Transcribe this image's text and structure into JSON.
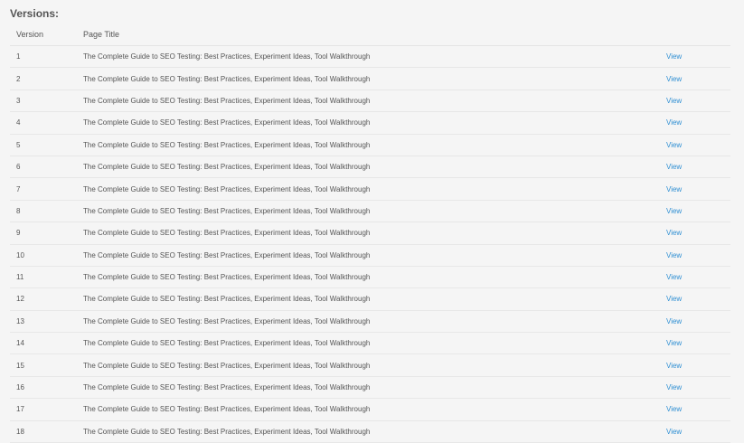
{
  "section": {
    "title": "Versions:"
  },
  "table": {
    "headers": {
      "version": "Version",
      "page_title": "Page Title"
    },
    "rows": [
      {
        "version": "1",
        "title": "The Complete Guide to SEO Testing: Best Practices, Experiment Ideas, Tool Walkthrough",
        "action": "View"
      },
      {
        "version": "2",
        "title": "The Complete Guide to SEO Testing: Best Practices, Experiment Ideas, Tool Walkthrough",
        "action": "View"
      },
      {
        "version": "3",
        "title": "The Complete Guide to SEO Testing: Best Practices, Experiment Ideas, Tool Walkthrough",
        "action": "View"
      },
      {
        "version": "4",
        "title": "The Complete Guide to SEO Testing: Best Practices, Experiment Ideas, Tool Walkthrough",
        "action": "View"
      },
      {
        "version": "5",
        "title": "The Complete Guide to SEO Testing: Best Practices, Experiment Ideas, Tool Walkthrough",
        "action": "View"
      },
      {
        "version": "6",
        "title": "The Complete Guide to SEO Testing: Best Practices, Experiment Ideas, Tool Walkthrough",
        "action": "View"
      },
      {
        "version": "7",
        "title": "The Complete Guide to SEO Testing: Best Practices, Experiment Ideas, Tool Walkthrough",
        "action": "View"
      },
      {
        "version": "8",
        "title": "The Complete Guide to SEO Testing: Best Practices, Experiment Ideas, Tool Walkthrough",
        "action": "View"
      },
      {
        "version": "9",
        "title": "The Complete Guide to SEO Testing: Best Practices, Experiment Ideas, Tool Walkthrough",
        "action": "View"
      },
      {
        "version": "10",
        "title": "The Complete Guide to SEO Testing: Best Practices, Experiment Ideas, Tool Walkthrough",
        "action": "View"
      },
      {
        "version": "11",
        "title": "The Complete Guide to SEO Testing: Best Practices, Experiment Ideas, Tool Walkthrough",
        "action": "View"
      },
      {
        "version": "12",
        "title": "The Complete Guide to SEO Testing: Best Practices, Experiment Ideas, Tool Walkthrough",
        "action": "View"
      },
      {
        "version": "13",
        "title": "The Complete Guide to SEO Testing: Best Practices, Experiment Ideas, Tool Walkthrough",
        "action": "View"
      },
      {
        "version": "14",
        "title": "The Complete Guide to SEO Testing: Best Practices, Experiment Ideas, Tool Walkthrough",
        "action": "View"
      },
      {
        "version": "15",
        "title": "The Complete Guide to SEO Testing: Best Practices, Experiment Ideas, Tool Walkthrough",
        "action": "View"
      },
      {
        "version": "16",
        "title": "The Complete Guide to SEO Testing: Best Practices, Experiment Ideas, Tool Walkthrough",
        "action": "View"
      },
      {
        "version": "17",
        "title": "The Complete Guide to SEO Testing: Best Practices, Experiment Ideas, Tool Walkthrough",
        "action": "View"
      },
      {
        "version": "18",
        "title": "The Complete Guide to SEO Testing: Best Practices, Experiment Ideas, Tool Walkthrough",
        "action": "View"
      }
    ]
  },
  "colors": {
    "background": "#f5f5f5",
    "text": "#555555",
    "link": "#2f8fd3",
    "divider": "#e7e7e7"
  }
}
